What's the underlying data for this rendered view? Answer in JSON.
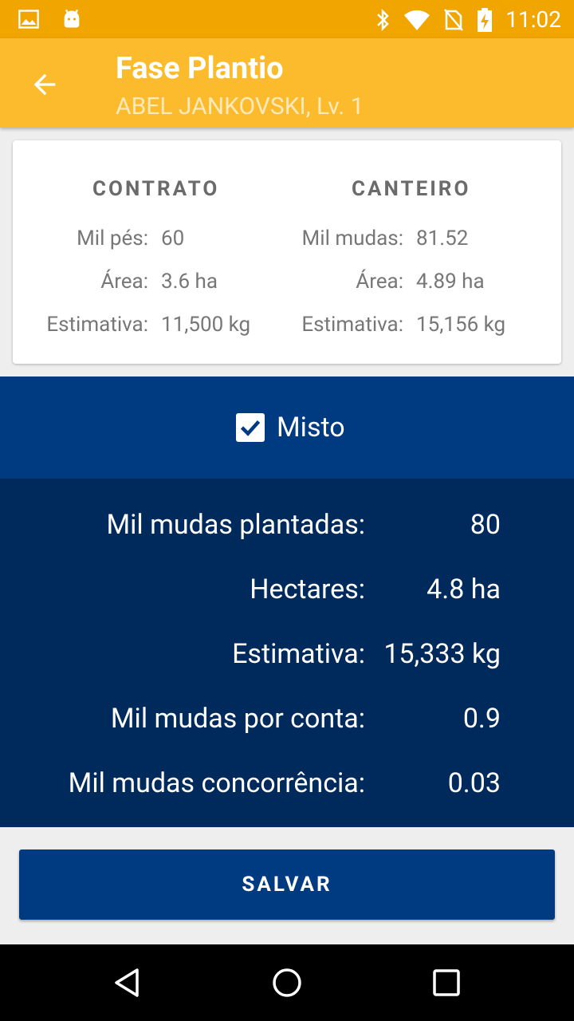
{
  "status_bar": {
    "time": "11:02",
    "icons": [
      "image-icon",
      "android-icon",
      "bluetooth-icon",
      "wifi-icon",
      "no-sim-icon",
      "battery-charging-icon"
    ]
  },
  "app_bar": {
    "title": "Fase Plantio",
    "subtitle": "ABEL JANKOVSKI, Lv. 1",
    "back_icon": "arrow-left-icon"
  },
  "contrato": {
    "heading": "CONTRATO",
    "rows": [
      {
        "label": "Mil pés:",
        "value": "60"
      },
      {
        "label": "Área:",
        "value": "3.6 ha"
      },
      {
        "label": "Estimativa:",
        "value": "11,500 kg"
      }
    ]
  },
  "canteiro": {
    "heading": "CANTEIRO",
    "rows": [
      {
        "label": "Mil mudas:",
        "value": "81.52"
      },
      {
        "label": "Área:",
        "value": "4.89 ha"
      },
      {
        "label": "Estimativa:",
        "value": "15,156 kg"
      }
    ]
  },
  "misto": {
    "label": "Misto",
    "checked": true
  },
  "results": [
    {
      "label": "Mil mudas plantadas:",
      "value": "80"
    },
    {
      "label": "Hectares:",
      "value": "4.8 ha"
    },
    {
      "label": "Estimativa:",
      "value": "15,333 kg"
    },
    {
      "label": "Mil mudas por conta:",
      "value": "0.9"
    },
    {
      "label": "Mil mudas concorrência:",
      "value": "0.03"
    }
  ],
  "save_label": "SALVAR",
  "nav": {
    "icons": [
      "back-triangle-icon",
      "home-circle-icon",
      "recents-square-icon"
    ]
  },
  "colors": {
    "status": "#f0a500",
    "appbar": "#fbbb2c",
    "primary": "#003a80",
    "dark": "#002a5c"
  }
}
